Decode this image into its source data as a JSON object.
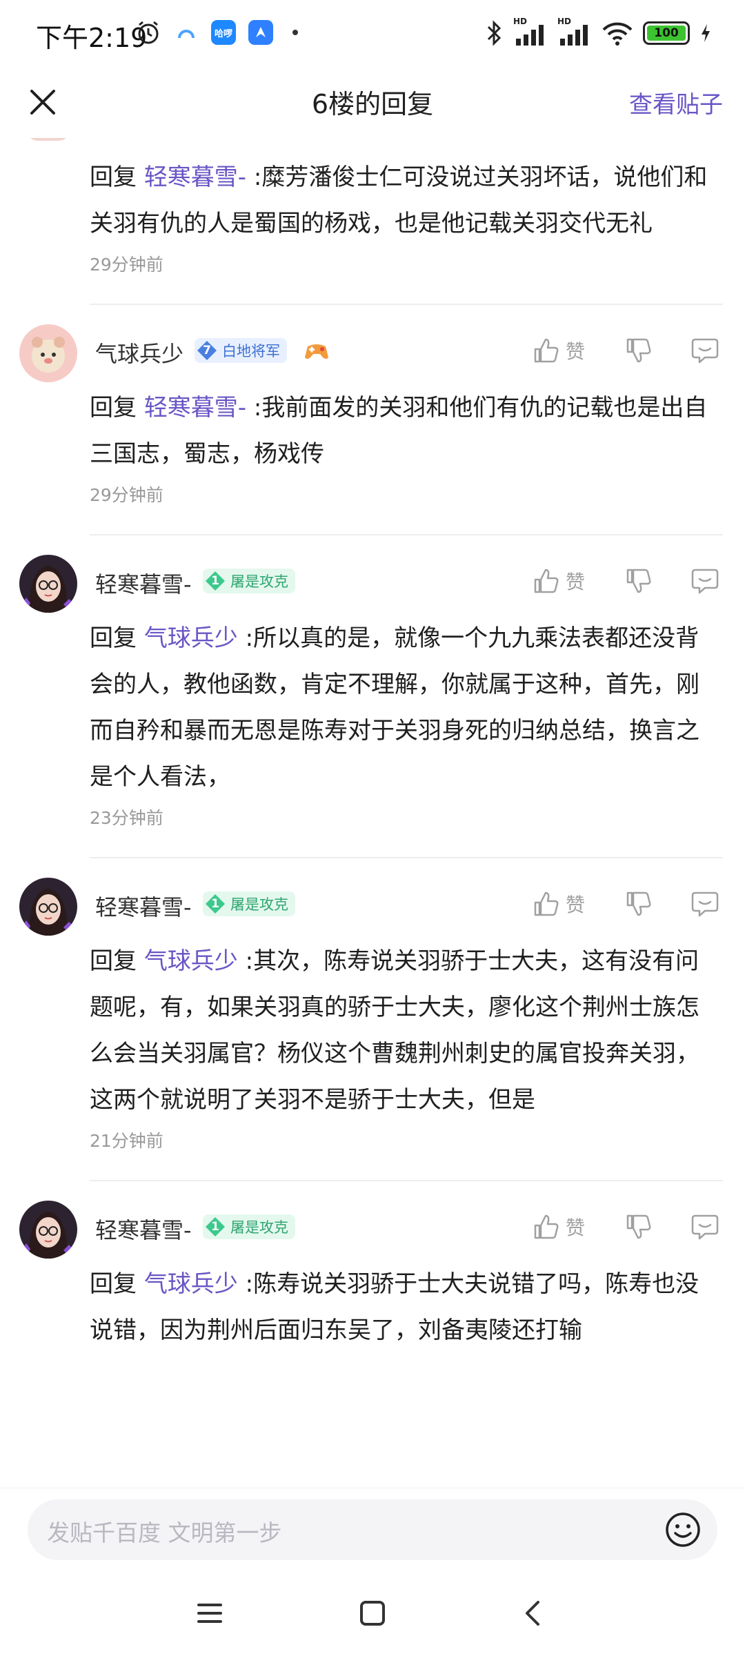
{
  "status_bar": {
    "time": "下午2:19",
    "app_icon_labels": [
      "哈啰"
    ],
    "battery": "100",
    "signal_labels": [
      "HD",
      "HD"
    ]
  },
  "header": {
    "title": "6楼的回复",
    "view_post": "查看贴子",
    "close_icon": "close-icon"
  },
  "replies": [
    {
      "partial": true,
      "reply_label": "回复",
      "target": "轻寒暮雪-",
      "text": ":糜芳潘俊士仁可没说过关羽坏话，说他们和关羽有仇的人是蜀国的杨戏，也是他记载关羽交代无礼",
      "time": "29分钟前"
    },
    {
      "username": "气球兵少",
      "level": "7",
      "title_badge": "白地将军",
      "badge_color": "#4a7fe0",
      "extra_icon": "controller-icon",
      "like_label": "赞",
      "reply_label": "回复",
      "target": "轻寒暮雪-",
      "text": ":我前面发的关羽和他们有仇的记载也是出自三国志，蜀志，杨戏传",
      "time": "29分钟前"
    },
    {
      "username": "轻寒暮雪-",
      "level": "1",
      "title_badge": "屠是攻克",
      "badge_color": "#3cc98d",
      "like_label": "赞",
      "reply_label": "回复",
      "target": "气球兵少",
      "text": ":所以真的是，就像一个九九乘法表都还没背会的人，教他函数，肯定不理解，你就属于这种，首先，刚而自矜和暴而无恩是陈寿对于关羽身死的归纳总结，换言之是个人看法，",
      "time": "23分钟前"
    },
    {
      "username": "轻寒暮雪-",
      "level": "1",
      "title_badge": "屠是攻克",
      "badge_color": "#3cc98d",
      "like_label": "赞",
      "reply_label": "回复",
      "target": "气球兵少",
      "text": ":其次，陈寿说关羽骄于士大夫，这有没有问题呢，有，如果关羽真的骄于士大夫，廖化这个荆州士族怎么会当关羽属官？杨仪这个曹魏荆州刺史的属官投奔关羽，这两个就说明了关羽不是骄于士大夫，但是",
      "time": "21分钟前"
    },
    {
      "username": "轻寒暮雪-",
      "level": "1",
      "title_badge": "屠是攻克",
      "badge_color": "#3cc98d",
      "like_label": "赞",
      "reply_label": "回复",
      "target": "气球兵少",
      "text": ":陈寿说关羽骄于士大夫说错了吗，陈寿也没说错，因为荆州后面归东吴了，刘备夷陵还打输",
      "time": ""
    }
  ],
  "input": {
    "placeholder": "发贴千百度 文明第一步"
  },
  "colors": {
    "accent": "#6a55c5",
    "muted": "#999999",
    "divider": "#ededed"
  }
}
